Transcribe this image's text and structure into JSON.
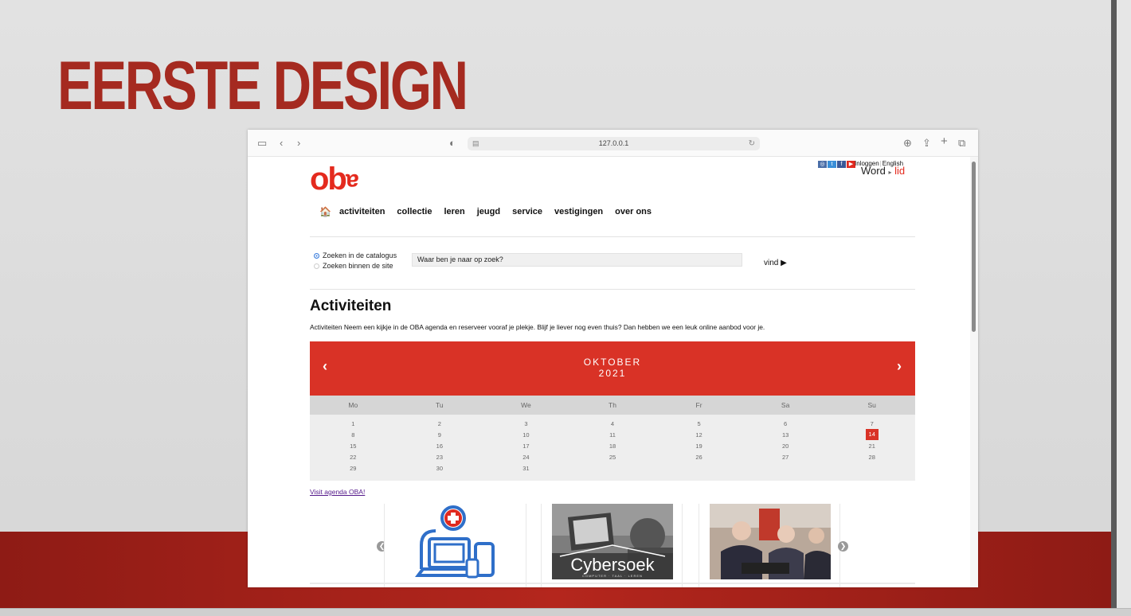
{
  "slide": {
    "title": "EERSTE DESIGN",
    "colors": {
      "title": "#a52a20",
      "band": "#b4261d"
    }
  },
  "browser": {
    "url": "127.0.0.1",
    "toolbar_icons": [
      "sidebar-icon",
      "back-icon",
      "forward-icon",
      "shield-icon",
      "download-icon",
      "share-icon",
      "new-tab-icon",
      "tabs-icon"
    ]
  },
  "site": {
    "logo": {
      "text": "ob",
      "tail": "a"
    },
    "social_icons": [
      "instagram-icon",
      "twitter-icon",
      "facebook-icon",
      "youtube-icon"
    ],
    "top_links": {
      "login": "Inloggen",
      "separator": "|",
      "english": "English"
    },
    "word_lid": {
      "word": "Word",
      "arrow": "▸",
      "lid": "lid"
    },
    "nav": {
      "home_icon": "🏠",
      "items": [
        "activiteiten",
        "collectie",
        "leren",
        "jeugd",
        "service",
        "vestigingen",
        "over ons"
      ]
    },
    "search": {
      "options": [
        "Zoeken in de catalogus",
        "Zoeken binnen de site"
      ],
      "selected": 0,
      "placeholder": "Waar ben je naar op zoek?",
      "button": "vind ▶"
    },
    "heading": "Activiteiten",
    "intro": "Activiteiten Neem een kijkje in de OBA agenda en reserveer vooraf je plekje. Blijf je liever nog even thuis? Dan hebben we een leuk online aanbod voor je.",
    "calendar": {
      "prev": "‹",
      "next": "›",
      "month": "OKTOBER",
      "year": "2021",
      "day_names": [
        "Mo",
        "Tu",
        "We",
        "Th",
        "Fr",
        "Sa",
        "Su"
      ],
      "weeks": [
        [
          "1",
          "2",
          "3",
          "4",
          "5",
          "6",
          "7"
        ],
        [
          "8",
          "9",
          "10",
          "11",
          "12",
          "13",
          "14"
        ],
        [
          "15",
          "16",
          "17",
          "18",
          "19",
          "20",
          "21"
        ],
        [
          "22",
          "23",
          "24",
          "25",
          "26",
          "27",
          "28"
        ],
        [
          "29",
          "30",
          "31",
          "",
          "",
          "",
          ""
        ]
      ],
      "today": "14",
      "accent": "#d93226"
    },
    "agenda_link": "Visit agenda OBA!",
    "carousel": {
      "prev": "❮",
      "next": "❯",
      "cards": [
        {
          "name": "computer-help-card",
          "caption": ""
        },
        {
          "name": "cybersoek-card",
          "caption": "Cybersoek",
          "subcaption": "COMPUTER · TAAL · LEREN"
        },
        {
          "name": "seniors-computer-card",
          "caption": ""
        }
      ]
    }
  }
}
